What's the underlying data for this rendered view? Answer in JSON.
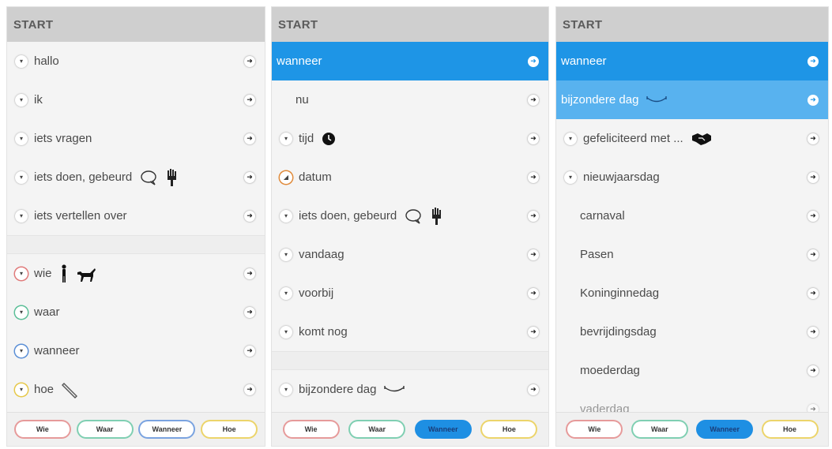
{
  "colors": {
    "header": "#cfcfcf",
    "selected": "#1e95e6",
    "selected_light": "#58b2ef"
  },
  "panels": [
    {
      "header": "START",
      "rows": [
        {
          "label": "hallo",
          "chevron": "plain"
        },
        {
          "label": "ik",
          "chevron": "plain"
        },
        {
          "label": "iets vragen",
          "chevron": "plain"
        },
        {
          "label": "iets doen, gebeurd",
          "chevron": "plain",
          "icons": [
            "speech-bubble-icon",
            "hand-tool-icon"
          ]
        },
        {
          "label": "iets vertellen over",
          "chevron": "plain"
        },
        {
          "gap": true
        },
        {
          "label": "wie",
          "chevron": "red",
          "icons": [
            "person-icon",
            "dog-icon"
          ]
        },
        {
          "label": "waar",
          "chevron": "green"
        },
        {
          "label": "wanneer",
          "chevron": "blue"
        },
        {
          "label": "hoe",
          "chevron": "yellow",
          "icons": [
            "pencil-icon"
          ]
        }
      ],
      "footer": [
        "Wie",
        "Waar",
        "Wanneer",
        "Hoe"
      ],
      "active_footer": ""
    },
    {
      "header": "START",
      "rows": [
        {
          "label": "wanneer",
          "state": "selected"
        },
        {
          "label": "nu",
          "indent": true
        },
        {
          "label": "tijd",
          "chevron": "plain",
          "icons": [
            "clock-icon"
          ]
        },
        {
          "label": "datum",
          "chevron": "pick"
        },
        {
          "label": "iets doen, gebeurd",
          "chevron": "plain",
          "icons": [
            "speech-bubble-icon",
            "hand-tool-icon"
          ]
        },
        {
          "label": "vandaag",
          "chevron": "plain"
        },
        {
          "label": "voorbij",
          "chevron": "plain"
        },
        {
          "label": "komt nog",
          "chevron": "plain"
        },
        {
          "gap": true
        },
        {
          "label": "bijzondere dag",
          "chevron": "plain",
          "icons": [
            "garland-icon"
          ]
        }
      ],
      "footer": [
        "Wie",
        "Waar",
        "Wanneer",
        "Hoe"
      ],
      "active_footer": "Wanneer"
    },
    {
      "header": "START",
      "rows": [
        {
          "label": "wanneer",
          "state": "selected"
        },
        {
          "label": "bijzondere dag",
          "state": "selected-light",
          "icons": [
            "garland-icon"
          ]
        },
        {
          "label": "gefeliciteerd met ...",
          "chevron": "plain",
          "icons": [
            "handshake-icon"
          ]
        },
        {
          "label": "nieuwjaarsdag",
          "chevron": "plain"
        },
        {
          "label": "carnaval",
          "indent": true
        },
        {
          "label": "Pasen",
          "indent": true
        },
        {
          "label": "Koninginnedag",
          "indent": true
        },
        {
          "label": "bevrijdingsdag",
          "indent": true
        },
        {
          "label": "moederdag",
          "indent": true
        },
        {
          "label": "vaderdag",
          "indent": true,
          "faded": true
        }
      ],
      "footer": [
        "Wie",
        "Waar",
        "Wanneer",
        "Hoe"
      ],
      "active_footer": "Wanneer"
    }
  ]
}
